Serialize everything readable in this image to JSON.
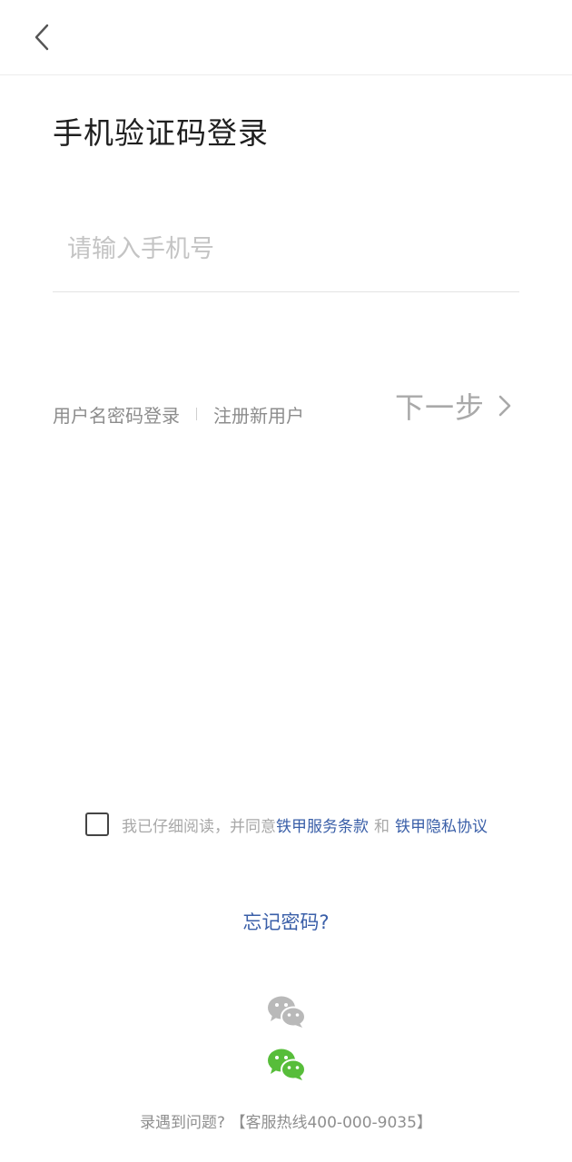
{
  "header": {
    "back_icon": "chevron-left-icon"
  },
  "title": "手机验证码登录",
  "phone_input": {
    "placeholder": "请输入手机号",
    "value": ""
  },
  "alt_links": {
    "password_login": "用户名密码登录",
    "register": "注册新用户"
  },
  "next_button": {
    "label": "下一步",
    "icon": "chevron-right-icon"
  },
  "agreement": {
    "checked": false,
    "prefix": "我已仔细阅读，并同意",
    "terms": "铁甲服务条款",
    "and": "和",
    "privacy": "铁甲隐私协议"
  },
  "forgot_password": "忘记密码?",
  "social_login": {
    "icons": [
      "wechat-gray-icon",
      "wechat-green-icon"
    ]
  },
  "footer": {
    "text": "录遇到问题?  【客服热线400-000-9035】"
  },
  "colors": {
    "link_blue": "#3a5fa8",
    "placeholder_gray": "#c4c4c4",
    "wechat_green": "#57bd3a",
    "wechat_gray": "#b9b9b9"
  }
}
